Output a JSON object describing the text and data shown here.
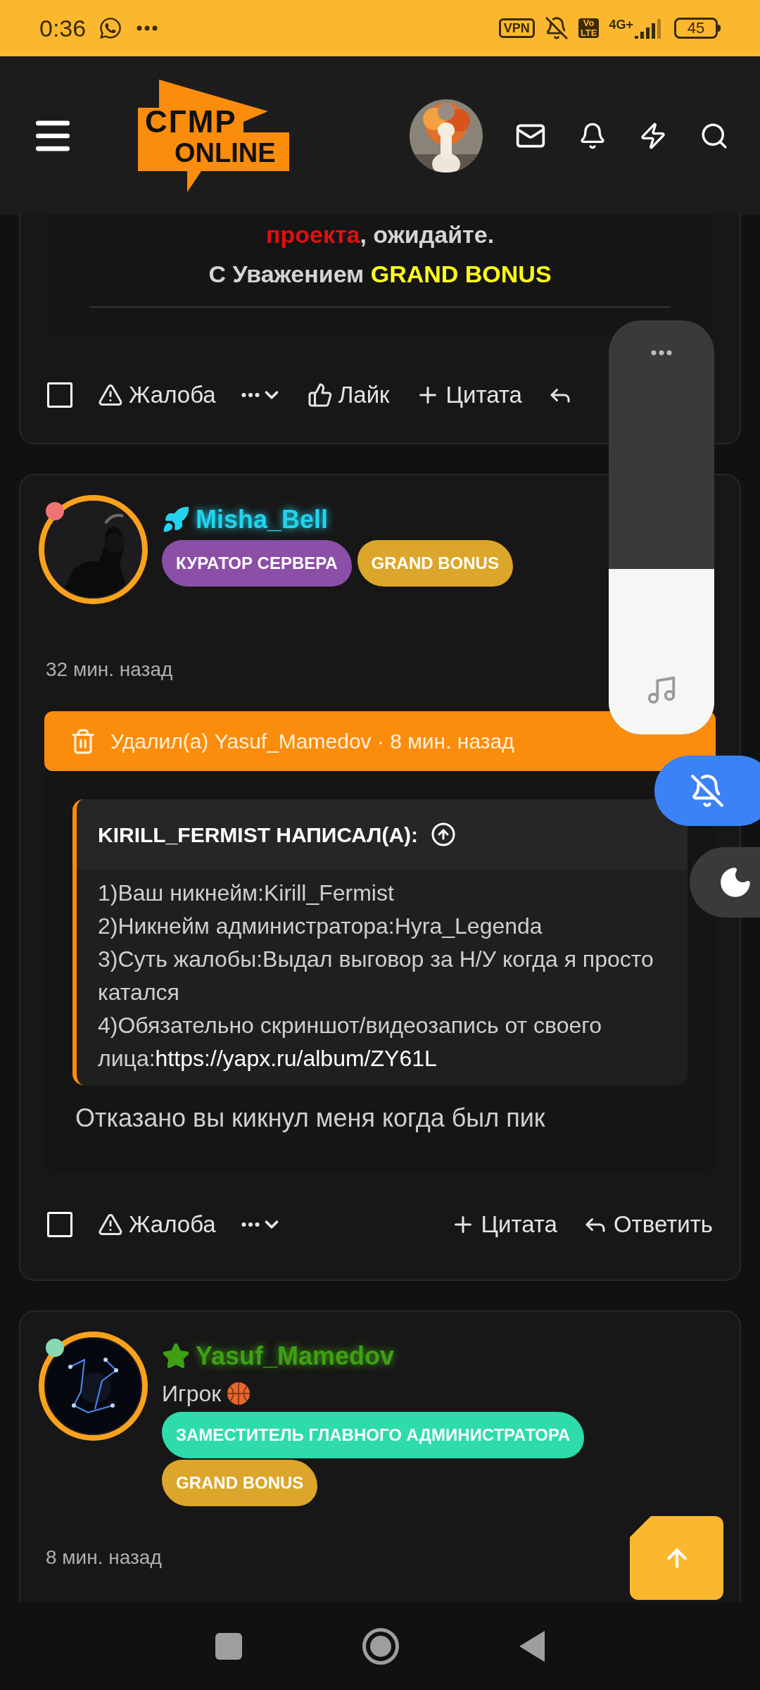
{
  "status_bar": {
    "time": "0:36",
    "vpn": "VPN",
    "volte": [
      "Vo",
      "LTE"
    ],
    "network": "4G+",
    "battery": "45"
  },
  "header": {
    "logo": [
      "СГМР",
      "ONLINE"
    ]
  },
  "posts": [
    {
      "kind": "tail",
      "lines": [
        [
          {
            "text": "проекта",
            "color": "#e01010"
          },
          {
            "text": ", ожидайте.",
            "color": "#d4d4d8"
          }
        ],
        [
          {
            "text": "С Уважением ",
            "color": "#d4d4d8"
          },
          {
            "text": "GRAND BONUS",
            "color": "#ffff1a"
          }
        ]
      ],
      "checked": false,
      "actions": [
        {
          "kind": "report",
          "label": "Жалоба"
        },
        {
          "kind": "more"
        },
        {
          "kind": "like",
          "label": "Лайк"
        },
        {
          "kind": "quote",
          "label": "Цитата"
        },
        {
          "kind": "reply"
        }
      ]
    },
    {
      "kind": "deleted",
      "author": {
        "name": "Misha_Bell",
        "color": "#22d3ee",
        "status": {
          "color": "#f07373"
        }
      },
      "badges": [
        {
          "label": "КУРАТОР СЕРВЕРА",
          "color": "#8b4fa8"
        },
        {
          "label": "GRAND BONUS",
          "color": "#dba62a"
        }
      ],
      "time": "32 мин. назад",
      "notice": "Удалил(а) Yasuf_Mamedov · 8 мин. назад",
      "quote": {
        "header": "KIRILL_FERMIST НАПИСАЛ(А):",
        "lines": [
          {
            "text": "1)Ваш никнейм:Kirill_Fermist"
          },
          {
            "text": "2)Никнейм администратора:Hyra_Legenda"
          },
          {
            "text": "3)Суть жалобы:Выдал выговор за Н/У когда я просто катался"
          },
          {
            "text": "4)Обязательно скриншот/видеозапись от своего лица:",
            "link": "https://yapx.ru/album/ZY61L"
          }
        ]
      },
      "body": "Отказано вы кикнул меня когда был пик",
      "checked": false,
      "actions": [
        {
          "kind": "report",
          "label": "Жалоба"
        },
        {
          "kind": "more"
        },
        {
          "kind": "quote",
          "label": "Цитата"
        },
        {
          "kind": "reply",
          "label": "Ответить"
        }
      ]
    },
    {
      "kind": "head",
      "author": {
        "name": "Yasuf_Mamedov",
        "color": "#3fa014",
        "status": {
          "color": "#86d9b0"
        }
      },
      "title": "Игрок",
      "badges": [
        {
          "label": "ЗАМЕСТИТЕЛЬ ГЛАВНОГО АДМИНИСТРАТОРА",
          "color": "#2ddcaa"
        },
        {
          "label": "GRAND BONUS",
          "color": "#dba62a"
        }
      ],
      "time": "8 мин. назад"
    }
  ],
  "volume": {
    "level": 0.4
  }
}
